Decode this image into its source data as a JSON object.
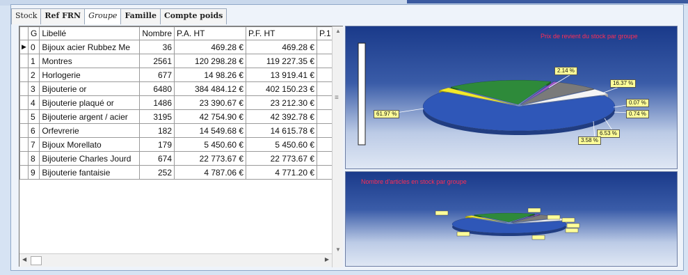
{
  "tabs": [
    "Stock",
    "Ref FRN",
    "Groupe",
    "Famille",
    "Compte poids"
  ],
  "active_tab": "Groupe",
  "table": {
    "columns": [
      "G",
      "Libellé",
      "Nombre",
      "P.A. HT",
      "P.F. HT",
      "P.1"
    ],
    "rows": [
      [
        "0",
        "Bijoux acier Rubbez Me",
        "36",
        "469.28 €",
        "469.28 €"
      ],
      [
        "1",
        "Montres",
        "2561",
        "120 298.28 €",
        "119 227.35 €"
      ],
      [
        "2",
        "Horlogerie",
        "677",
        "14 98.26 €",
        "13 919.41 €"
      ],
      [
        "3",
        "Bijouterie or",
        "6480",
        "384 484.12 €",
        "402 150.23 €"
      ],
      [
        "4",
        "Bijouterie plaqué or",
        "1486",
        "23 390.67 €",
        "23 212.30 €"
      ],
      [
        "5",
        "Bijouterie argent / acier",
        "3195",
        "42 754.90 €",
        "42 392.78 €"
      ],
      [
        "6",
        "Orfevrerie",
        "182",
        "14 549.68 €",
        "14 615.78 €"
      ],
      [
        "7",
        "Bijoux Morellato",
        "179",
        "5 450.60 €",
        "5 450.60 €"
      ],
      [
        "8",
        "Bijouterie Charles Jourd",
        "674",
        "22 773.67 €",
        "22 773.67 €"
      ],
      [
        "9",
        "Bijouterie fantaisie",
        "252",
        "4 787.06 €",
        "4 771.20 €"
      ]
    ]
  },
  "chart_data": [
    {
      "type": "pie",
      "title": "Prix de revient du stock par groupe",
      "labels": [
        "61.97 %",
        "2.14 %",
        "16.37 %",
        "0.07 %",
        "0.74 %",
        "6.53 %",
        "3.58 %"
      ],
      "values": [
        61.97,
        2.14,
        16.37,
        0.07,
        0.74,
        6.53,
        3.58
      ],
      "colors": [
        "#2f57b8",
        "#f2e92a",
        "#2e8a3a",
        "#3e6fd0",
        "#9b59c6",
        "#7a7a7a",
        "#f5f5f5"
      ]
    },
    {
      "type": "pie",
      "title": "Nombre d'articles en stock par groupe",
      "values": [],
      "colors": [
        "#2f57b8",
        "#f2e92a",
        "#2e8a3a",
        "#3e6fd0",
        "#9b59c6",
        "#7a7a7a",
        "#f5f5f5"
      ]
    }
  ]
}
